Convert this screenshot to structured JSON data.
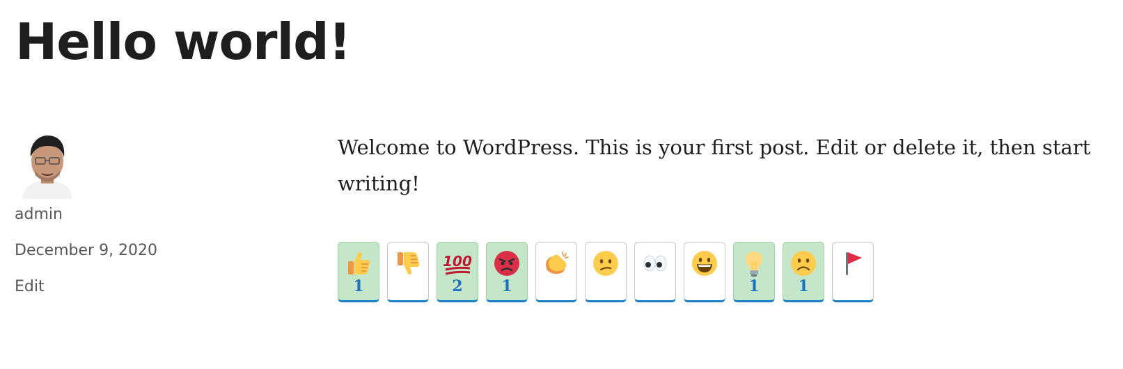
{
  "post": {
    "title": "Hello world!",
    "content": "Welcome to WordPress. This is your first post. Edit or delete it, then start writing!"
  },
  "meta": {
    "author": "admin",
    "date": "December 9, 2020",
    "edit_label": "Edit"
  },
  "reactions": [
    {
      "icon": "thumbs-up-icon",
      "count": "1",
      "active": true
    },
    {
      "icon": "thumbs-down-icon",
      "count": "",
      "active": false
    },
    {
      "icon": "hundred-points-icon",
      "count": "2",
      "active": true
    },
    {
      "icon": "angry-face-icon",
      "count": "1",
      "active": true
    },
    {
      "icon": "clapping-hands-icon",
      "count": "",
      "active": false
    },
    {
      "icon": "confused-face-icon",
      "count": "",
      "active": false
    },
    {
      "icon": "eyes-icon",
      "count": "",
      "active": false
    },
    {
      "icon": "grinning-face-icon",
      "count": "",
      "active": false
    },
    {
      "icon": "light-bulb-icon",
      "count": "1",
      "active": true
    },
    {
      "icon": "frowning-face-icon",
      "count": "1",
      "active": true
    },
    {
      "icon": "flag-icon",
      "count": "",
      "active": false
    }
  ],
  "colors": {
    "active_background": "#c5e6c9",
    "count_text": "#1e73be",
    "bottom_border": "#1e7fc7"
  }
}
